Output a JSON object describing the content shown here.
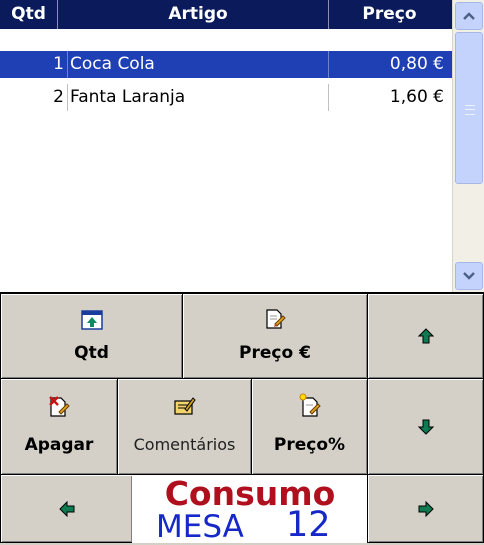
{
  "table": {
    "headers": {
      "qtd": "Qtd",
      "artigo": "Artigo",
      "preco": "Preço"
    },
    "rows": [
      {
        "qtd": "1",
        "artigo": "Coca Cola",
        "preco": "0,80 €",
        "selected": true
      },
      {
        "qtd": "2",
        "artigo": "Fanta Laranja",
        "preco": "1,60 €",
        "selected": false
      }
    ]
  },
  "scrollbar": {
    "up_glyph": "▴",
    "down_glyph": "▾"
  },
  "buttons": {
    "qtd": "Qtd",
    "preco_eur": "Preço €",
    "apagar": "Apagar",
    "comentarios": "Comentários",
    "preco_pct": "Preço%"
  },
  "consumo": {
    "title": "Consumo",
    "mesa_label": "MESA",
    "mesa_number": "12"
  },
  "colors": {
    "header_bg": "#0a1a5a",
    "selected_row_bg": "#1f3fb4",
    "arrow_green": "#0e7a52",
    "consumo_red": "#b0101e",
    "mesa_blue": "#1728c9"
  },
  "icons": [
    "table-up-icon",
    "price-edit-icon",
    "delete-edit-icon",
    "comment-icon",
    "price-percent-icon",
    "arrow-up-icon",
    "arrow-down-icon",
    "arrow-left-icon",
    "arrow-right-icon"
  ]
}
